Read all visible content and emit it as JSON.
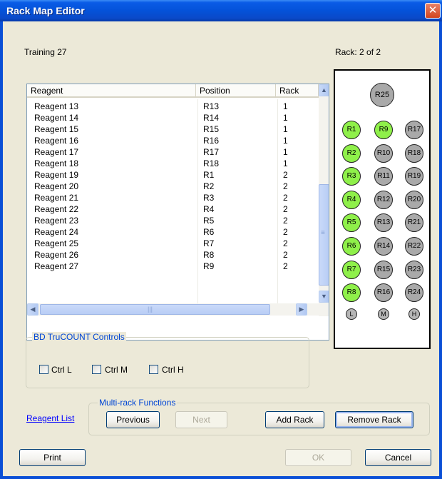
{
  "window": {
    "title": "Rack Map Editor",
    "close_glyph": "✕"
  },
  "header": {
    "training_name": "Training 27",
    "rack_label": "Rack:  2 of 2"
  },
  "table": {
    "columns": [
      "Reagent",
      "Position",
      "Rack"
    ],
    "rows": [
      [
        "Reagent 13",
        "R13",
        "1"
      ],
      [
        "Reagent 14",
        "R14",
        "1"
      ],
      [
        "Reagent 15",
        "R15",
        "1"
      ],
      [
        "Reagent 16",
        "R16",
        "1"
      ],
      [
        "Reagent 17",
        "R17",
        "1"
      ],
      [
        "Reagent 18",
        "R18",
        "1"
      ],
      [
        "Reagent 19",
        "R1",
        "2"
      ],
      [
        "Reagent 20",
        "R2",
        "2"
      ],
      [
        "Reagent 21",
        "R3",
        "2"
      ],
      [
        "Reagent 22",
        "R4",
        "2"
      ],
      [
        "Reagent 23",
        "R5",
        "2"
      ],
      [
        "Reagent 24",
        "R6",
        "2"
      ],
      [
        "Reagent 25",
        "R7",
        "2"
      ],
      [
        "Reagent 26",
        "R8",
        "2"
      ],
      [
        "Reagent 27",
        "R9",
        "2"
      ]
    ],
    "scroll_up_glyph": "▲",
    "scroll_down_glyph": "▼",
    "scroll_left_glyph": "◀",
    "scroll_right_glyph": "▶",
    "grip_glyph": "≡",
    "hgrip_glyph": "|||"
  },
  "rack": {
    "top_tube": "R25",
    "columns": [
      [
        {
          "label": "R1",
          "filled": true
        },
        {
          "label": "R2",
          "filled": true
        },
        {
          "label": "R3",
          "filled": true
        },
        {
          "label": "R4",
          "filled": true
        },
        {
          "label": "R5",
          "filled": true
        },
        {
          "label": "R6",
          "filled": true
        },
        {
          "label": "R7",
          "filled": true
        },
        {
          "label": "R8",
          "filled": true
        }
      ],
      [
        {
          "label": "R9",
          "filled": true
        },
        {
          "label": "R10",
          "filled": false
        },
        {
          "label": "R11",
          "filled": false
        },
        {
          "label": "R12",
          "filled": false
        },
        {
          "label": "R13",
          "filled": false
        },
        {
          "label": "R14",
          "filled": false
        },
        {
          "label": "R15",
          "filled": false
        },
        {
          "label": "R16",
          "filled": false
        }
      ],
      [
        {
          "label": "R17",
          "filled": false
        },
        {
          "label": "R18",
          "filled": false
        },
        {
          "label": "R19",
          "filled": false
        },
        {
          "label": "R20",
          "filled": false
        },
        {
          "label": "R21",
          "filled": false
        },
        {
          "label": "R22",
          "filled": false
        },
        {
          "label": "R23",
          "filled": false
        },
        {
          "label": "R24",
          "filled": false
        }
      ]
    ],
    "controls": [
      "L",
      "M",
      "H"
    ],
    "colors": {
      "filled": "#8ff04a",
      "empty": "#a9a9a9"
    }
  },
  "trucount": {
    "title": "BD TruCOUNT Controls",
    "checkboxes": [
      {
        "label": "Ctrl L",
        "checked": false
      },
      {
        "label": "Ctrl M",
        "checked": false
      },
      {
        "label": "Ctrl H",
        "checked": false
      }
    ]
  },
  "multirack": {
    "title": "Multi-rack Functions",
    "reagent_list_link": "Reagent List",
    "previous": "Previous",
    "next": "Next",
    "add_rack": "Add Rack",
    "remove_rack": "Remove Rack"
  },
  "footer": {
    "print": "Print",
    "ok": "OK",
    "cancel": "Cancel"
  },
  "colors": {
    "title_bar": "#0452d9",
    "dialog_bg": "#ece9d8",
    "group_title": "#0046d5"
  }
}
